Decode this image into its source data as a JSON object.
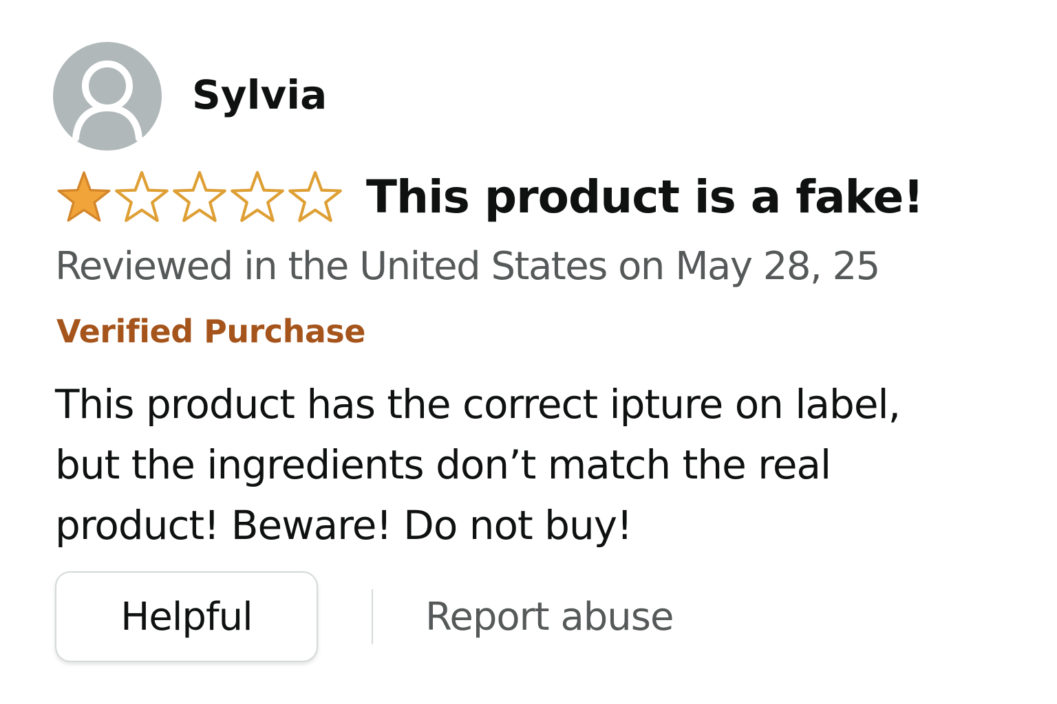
{
  "review": {
    "profile": {
      "name": "Sylvia",
      "avatar_icon": "user-silhouette-icon",
      "avatar_bg": "#b0b8ba"
    },
    "rating": {
      "value": 1,
      "max": 5,
      "filled_color": "#f0a43a",
      "outline_color": "#de9f34",
      "icons": [
        "star-filled-icon",
        "star-empty-icon"
      ]
    },
    "title": "This product is a fake!",
    "date_text": "Reviewed in the United States on May 28, 25",
    "verified_label": "Verified Purchase",
    "body_lines": [
      "This product has the correct ipture on label,",
      "but the ingredients don’t match the real",
      "product! Beware! Do not buy!"
    ],
    "actions": {
      "helpful_label": "Helpful",
      "report_label": "Report abuse"
    },
    "colors": {
      "text": "#0f1111",
      "muted": "#565959",
      "verified": "#a5541b"
    }
  }
}
